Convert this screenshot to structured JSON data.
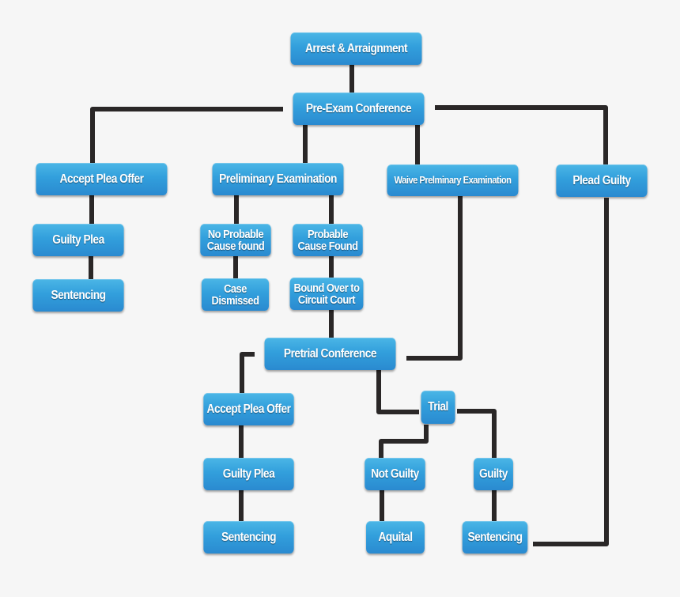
{
  "diagram": {
    "type": "flowchart",
    "title": "",
    "nodes": {
      "arrest": {
        "label": "Arrest & Arraignment"
      },
      "pre_exam": {
        "label": "Pre-Exam Conference"
      },
      "accept_plea_1": {
        "label": "Accept Plea Offer"
      },
      "guilty_plea_1": {
        "label": "Guilty Plea"
      },
      "sentencing_1": {
        "label": "Sentencing"
      },
      "prelim_exam": {
        "label": "Preliminary Examination"
      },
      "no_probable": {
        "label": "No Probable\nCause found"
      },
      "case_dismissed": {
        "label": "Case\nDismissed"
      },
      "probable": {
        "label": "Probable\nCause Found"
      },
      "bound_over": {
        "label": "Bound Over to\nCircuit Court"
      },
      "waive_prelim": {
        "label": "Waive Prelminary Examination"
      },
      "plead_guilty": {
        "label": "Plead Guilty"
      },
      "pretrial": {
        "label": "Pretrial Conference"
      },
      "accept_plea_2": {
        "label": "Accept Plea Offer"
      },
      "guilty_plea_2": {
        "label": "Guilty Plea"
      },
      "sentencing_2": {
        "label": "Sentencing"
      },
      "trial": {
        "label": "Trial"
      },
      "not_guilty": {
        "label": "Not Guilty"
      },
      "aquital": {
        "label": "Aquital"
      },
      "guilty": {
        "label": "Guilty"
      },
      "sentencing_3": {
        "label": "Sentencing"
      }
    },
    "edges": [
      [
        "arrest",
        "pre_exam"
      ],
      [
        "pre_exam",
        "accept_plea_1"
      ],
      [
        "pre_exam",
        "prelim_exam"
      ],
      [
        "pre_exam",
        "waive_prelim"
      ],
      [
        "pre_exam",
        "plead_guilty"
      ],
      [
        "accept_plea_1",
        "guilty_plea_1"
      ],
      [
        "guilty_plea_1",
        "sentencing_1"
      ],
      [
        "prelim_exam",
        "no_probable"
      ],
      [
        "prelim_exam",
        "probable"
      ],
      [
        "no_probable",
        "case_dismissed"
      ],
      [
        "probable",
        "bound_over"
      ],
      [
        "bound_over",
        "pretrial"
      ],
      [
        "waive_prelim",
        "pretrial"
      ],
      [
        "plead_guilty",
        "sentencing_3"
      ],
      [
        "pretrial",
        "accept_plea_2"
      ],
      [
        "pretrial",
        "trial"
      ],
      [
        "accept_plea_2",
        "guilty_plea_2"
      ],
      [
        "guilty_plea_2",
        "sentencing_2"
      ],
      [
        "trial",
        "not_guilty"
      ],
      [
        "trial",
        "guilty"
      ],
      [
        "not_guilty",
        "aquital"
      ],
      [
        "guilty",
        "sentencing_3"
      ]
    ],
    "colors": {
      "node_fill": "#329fdc",
      "node_text": "#ffffff",
      "connector": "#2a2727",
      "background": "#f6f6f6"
    }
  }
}
